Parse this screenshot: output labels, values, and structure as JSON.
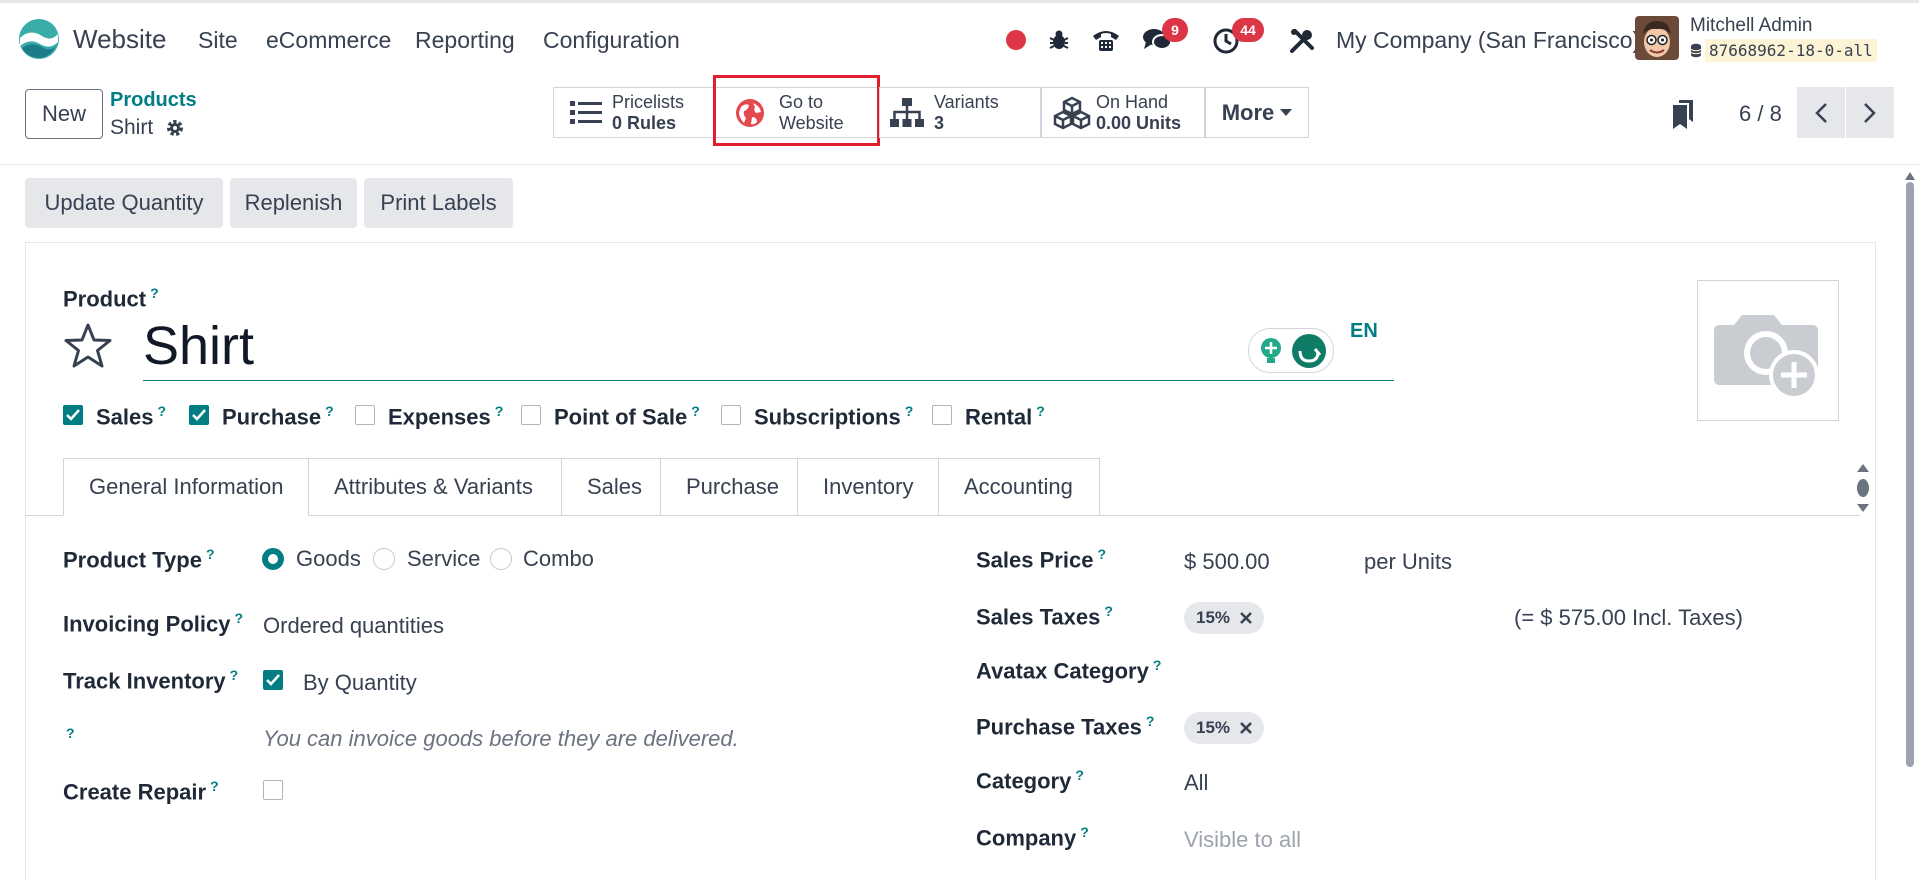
{
  "navbar": {
    "app_name": "Website",
    "menu": [
      "Site",
      "eCommerce",
      "Reporting",
      "Configuration"
    ],
    "messages_count": "9",
    "activities_count": "44",
    "company": "My Company (San Francisco)",
    "user_name": "Mitchell Admin",
    "db_name": "87668962-18-0-all"
  },
  "control_panel": {
    "new_label": "New",
    "breadcrumb_parent": "Products",
    "breadcrumb_current": "Shirt",
    "smart_buttons": {
      "pricelists_label": "Pricelists",
      "pricelists_value": "0 Rules",
      "website_line1": "Go to",
      "website_line2": "Website",
      "variants_label": "Variants",
      "variants_value": "3",
      "onhand_label": "On Hand",
      "onhand_value": "0.00 Units",
      "more_label": "More"
    },
    "pager": "6 / 8"
  },
  "actions": [
    "Update Quantity",
    "Replenish",
    "Print Labels"
  ],
  "form": {
    "product_label": "Product",
    "product_name": "Shirt",
    "lang": "EN",
    "checkboxes": [
      {
        "label": "Sales",
        "checked": true
      },
      {
        "label": "Purchase",
        "checked": true
      },
      {
        "label": "Expenses",
        "checked": false
      },
      {
        "label": "Point of Sale",
        "checked": false
      },
      {
        "label": "Subscriptions",
        "checked": false
      },
      {
        "label": "Rental",
        "checked": false
      }
    ],
    "tabs": [
      "General Information",
      "Attributes & Variants",
      "Sales",
      "Purchase",
      "Inventory",
      "Accounting"
    ],
    "left": {
      "product_type_label": "Product Type",
      "type_options": [
        "Goods",
        "Service",
        "Combo"
      ],
      "invoicing_label": "Invoicing Policy",
      "invoicing_value": "Ordered quantities",
      "track_label": "Track Inventory",
      "track_value": "By Quantity",
      "hint": "You can invoice goods before they are delivered.",
      "repair_label": "Create Repair"
    },
    "right": {
      "sales_price_label": "Sales Price",
      "sales_price_value": "$ 500.00",
      "per_units": "per Units",
      "sales_taxes_label": "Sales Taxes",
      "sales_tax_tag": "15%",
      "incl_taxes": "(= $ 575.00 Incl. Taxes)",
      "avatax_label": "Avatax Category",
      "purchase_taxes_label": "Purchase Taxes",
      "purchase_tax_tag": "15%",
      "category_label": "Category",
      "category_value": "All",
      "company_label": "Company",
      "company_placeholder": "Visible to all"
    },
    "help_mark": "?"
  },
  "colors": {
    "accent": "#017e84",
    "badge": "#dc3545",
    "highlight": "#e11d2e"
  }
}
